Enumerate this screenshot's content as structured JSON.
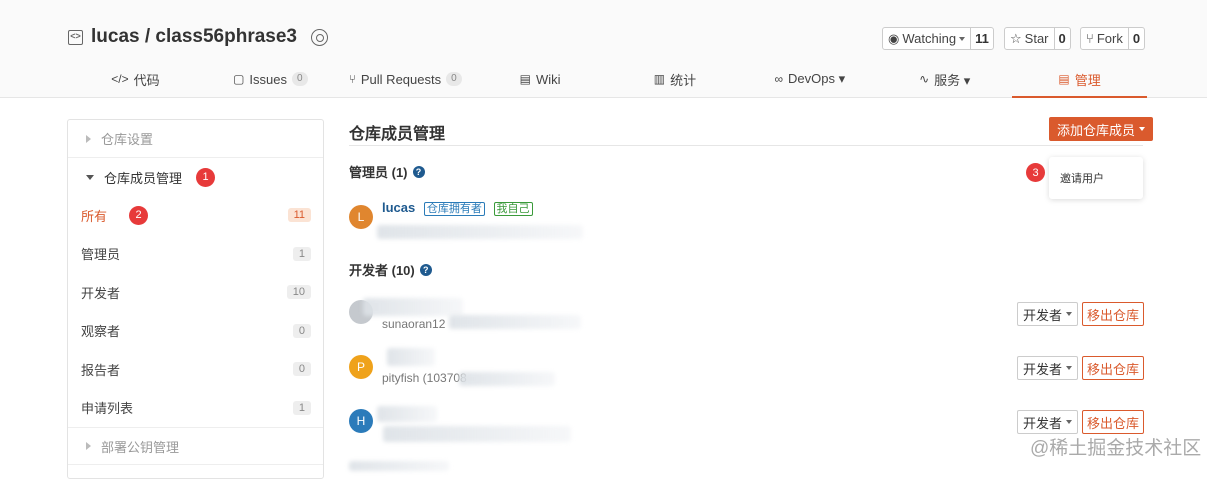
{
  "repo": {
    "title": "lucas / class56phrase3"
  },
  "social": [
    {
      "label": "Watching",
      "count": "11",
      "icon": "eye-icon"
    },
    {
      "label": "Star",
      "count": "0",
      "icon": "star-icon"
    },
    {
      "label": "Fork",
      "count": "0",
      "icon": "fork-icon"
    }
  ],
  "tabs": [
    {
      "label": "代码",
      "icon": "</>",
      "badge": ""
    },
    {
      "label": "Issues",
      "icon": "▢",
      "badge": "0"
    },
    {
      "label": "Pull Requests",
      "icon": "⑂",
      "badge": "0"
    },
    {
      "label": "Wiki",
      "icon": "▤",
      "badge": ""
    },
    {
      "label": "统计",
      "icon": "▥",
      "badge": ""
    },
    {
      "label": "DevOps ▾",
      "icon": "∞",
      "badge": ""
    },
    {
      "label": "服务 ▾",
      "icon": "∿",
      "badge": ""
    },
    {
      "label": "管理",
      "icon": "▤",
      "badge": ""
    }
  ],
  "sidebar": {
    "sec_repo_settings": "仓库设置",
    "sec_members": "仓库成员管理",
    "marker1": "1",
    "marker2": "2",
    "items": [
      {
        "label": "所有",
        "count": "11"
      },
      {
        "label": "管理员",
        "count": "1"
      },
      {
        "label": "开发者",
        "count": "10"
      },
      {
        "label": "观察者",
        "count": "0"
      },
      {
        "label": "报告者",
        "count": "0"
      },
      {
        "label": "申请列表",
        "count": "1"
      }
    ],
    "sec_deploy_keys": "部署公钥管理"
  },
  "main": {
    "title": "仓库成员管理",
    "add_button": "添加仓库成员",
    "dropdown_item": "邀请用户",
    "marker3": "3",
    "admins_title": "管理员 (1)",
    "devs_title": "开发者 (10)",
    "admin": {
      "name": "lucas",
      "avatar": "L",
      "tag_owner": "仓库拥有者",
      "tag_me": "我自己"
    },
    "devs": [
      {
        "avatar": "",
        "sub": "sunaoran12",
        "role": "开发者",
        "remove": "移出仓库"
      },
      {
        "avatar": "P",
        "sub": "pityfish (103708",
        "role": "开发者",
        "remove": "移出仓库"
      },
      {
        "avatar": "H",
        "sub": "",
        "role": "开发者",
        "remove": "移出仓库"
      }
    ]
  },
  "watermark": "@稀土掘金技术社区",
  "colors": {
    "accent": "#da5a2d",
    "link": "#1f5a8f",
    "marker": "#e73a3a"
  }
}
